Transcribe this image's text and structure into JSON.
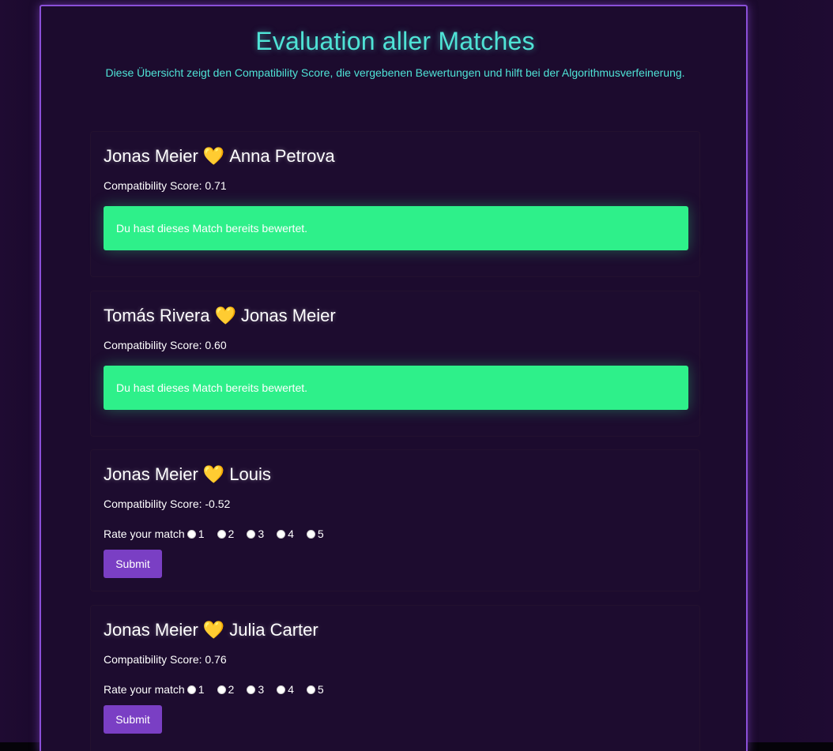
{
  "header": {
    "title": "Evaluation aller Matches",
    "subtitle": "Diese Übersicht zeigt den Compatibility Score, die vergebenen Bewertungen und hilft bei der Algorithmusverfeinerung."
  },
  "matches": [
    {
      "person_a": "Jonas Meier",
      "person_b": "Anna Petrova",
      "score_label": "Compatibility Score: 0.71",
      "rated": true,
      "rated_message": "Du hast dieses Match bereits bewertet."
    },
    {
      "person_a": "Tomás Rivera",
      "person_b": "Jonas Meier",
      "score_label": "Compatibility Score: 0.60",
      "rated": true,
      "rated_message": "Du hast dieses Match bereits bewertet."
    },
    {
      "person_a": "Jonas Meier",
      "person_b": "Louis",
      "score_label": "Compatibility Score: -0.52",
      "rated": false,
      "rate_label": "Rate your match",
      "options": [
        "1",
        "2",
        "3",
        "4",
        "5"
      ],
      "submit_label": "Submit"
    },
    {
      "person_a": "Jonas Meier",
      "person_b": "Julia Carter",
      "score_label": "Compatibility Score: 0.76",
      "rated": false,
      "rate_label": "Rate your match",
      "options": [
        "1",
        "2",
        "3",
        "4",
        "5"
      ],
      "submit_label": "Submit"
    }
  ],
  "icons": {
    "match_icon": "handshake-icon"
  },
  "colors": {
    "accent_cyan": "#4fe3d6",
    "rated_green": "#2ef08a",
    "button_purple": "#7a3fc4",
    "border_purple": "#8a4fd8",
    "background": "#1c0b2e"
  }
}
